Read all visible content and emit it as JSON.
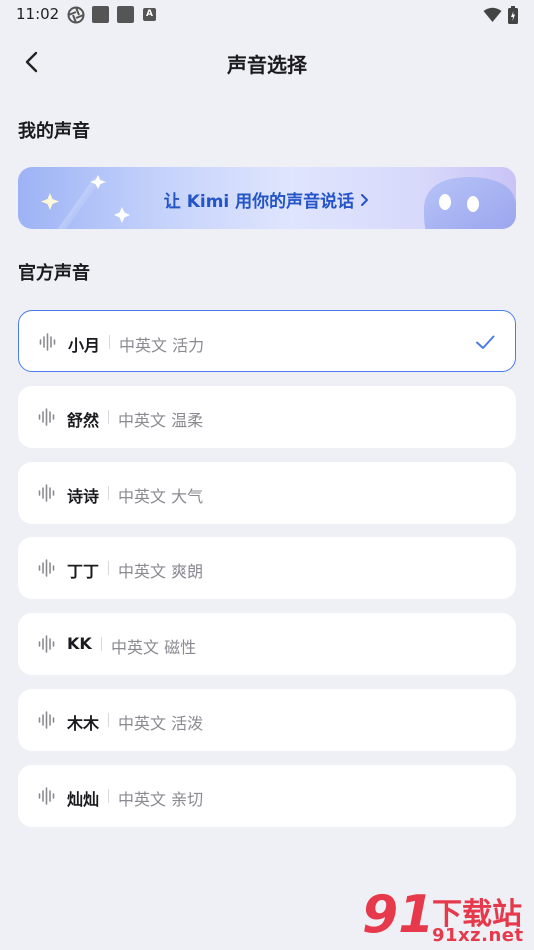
{
  "status_bar": {
    "time": "11:02"
  },
  "header": {
    "title": "声音选择"
  },
  "my_voice": {
    "section_title": "我的声音",
    "banner_text": "让 Kimi 用你的声音说话"
  },
  "official_voice": {
    "section_title": "官方声音"
  },
  "voices": [
    {
      "name": "小月",
      "tags": "中英文 活力",
      "selected": true
    },
    {
      "name": "舒然",
      "tags": "中英文 温柔",
      "selected": false
    },
    {
      "name": "诗诗",
      "tags": "中英文 大气",
      "selected": false
    },
    {
      "name": "丁丁",
      "tags": "中英文 爽朗",
      "selected": false
    },
    {
      "name": "KK",
      "tags": "中英文 磁性",
      "selected": false
    },
    {
      "name": "木木",
      "tags": "中英文 活泼",
      "selected": false
    },
    {
      "name": "灿灿",
      "tags": "中英文 亲切",
      "selected": false
    }
  ],
  "watermark": {
    "big": "91",
    "title": "下载站",
    "url": "91xz.net"
  },
  "colors": {
    "accent": "#4a7cf0",
    "banner_text": "#2454c7",
    "background": "#eff0f6"
  }
}
